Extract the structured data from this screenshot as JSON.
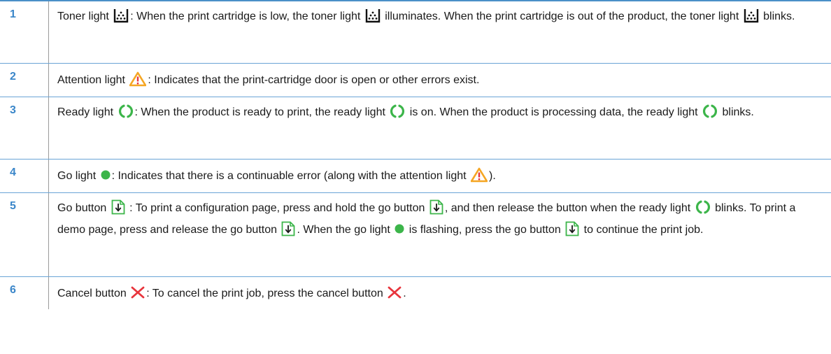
{
  "rows": [
    {
      "num": "1",
      "parts": [
        {
          "t": "Toner light "
        },
        {
          "icon": "toner"
        },
        {
          "t": ": When the print cartridge is low, the toner light "
        },
        {
          "icon": "toner"
        },
        {
          "t": " illuminates. When the print cartridge is out of the product, the toner light "
        },
        {
          "icon": "toner"
        },
        {
          "t": " blinks."
        }
      ]
    },
    {
      "num": "2",
      "parts": [
        {
          "t": "Attention light "
        },
        {
          "icon": "attention"
        },
        {
          "t": ": Indicates that the print-cartridge door is open or other errors exist."
        }
      ]
    },
    {
      "num": "3",
      "parts": [
        {
          "t": "Ready light "
        },
        {
          "icon": "ready"
        },
        {
          "t": ": When the product is ready to print, the ready light "
        },
        {
          "icon": "ready"
        },
        {
          "t": " is on. When the product is processing data, the ready light "
        },
        {
          "icon": "ready"
        },
        {
          "t": " blinks."
        }
      ]
    },
    {
      "num": "4",
      "parts": [
        {
          "t": "Go light "
        },
        {
          "icon": "go-light"
        },
        {
          "t": ": Indicates that there is a continuable error (along with the attention light "
        },
        {
          "icon": "attention"
        },
        {
          "t": ")."
        }
      ]
    },
    {
      "num": "5",
      "parts": [
        {
          "t": "Go button "
        },
        {
          "icon": "go-button"
        },
        {
          "t": " : To print a configuration page, press and hold the go button "
        },
        {
          "icon": "go-button"
        },
        {
          "t": ", and then release the button when the ready light "
        },
        {
          "icon": "ready"
        },
        {
          "t": " blinks. To print a demo page, press and release the go button "
        },
        {
          "icon": "go-button"
        },
        {
          "t": ". When the go light "
        },
        {
          "icon": "go-light"
        },
        {
          "t": " is flashing, press the go button "
        },
        {
          "icon": "go-button"
        },
        {
          "t": " to continue the print job."
        }
      ]
    },
    {
      "num": "6",
      "parts": [
        {
          "t": "Cancel button "
        },
        {
          "icon": "cancel"
        },
        {
          "t": ": To cancel the print job, press the cancel button "
        },
        {
          "icon": "cancel"
        },
        {
          "t": "."
        }
      ]
    }
  ],
  "colors": {
    "number": "#3a86c9",
    "attention": "#f5a623",
    "ready": "#3cb54a",
    "cancel": "#e8343c"
  }
}
